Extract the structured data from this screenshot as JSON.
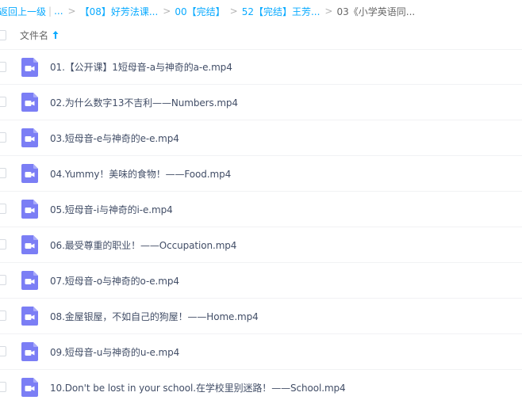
{
  "breadcrumb": {
    "back": "返回上一级",
    "separator": "|",
    "ellipsis": "...",
    "arrow": ">",
    "crumbs": [
      "【08】好芳法课...",
      "00【完结】",
      "52【完结】王芳...",
      "03《小学英语同..."
    ]
  },
  "header": {
    "column_label": "文件名"
  },
  "files": [
    {
      "name": "01.【公开课】1短母音-a与神奇的a-e.mp4",
      "icon": "video-icon"
    },
    {
      "name": "02.为什么数字13不吉利——Numbers.mp4",
      "icon": "video-icon"
    },
    {
      "name": "03.短母音-e与神奇的e-e.mp4",
      "icon": "video-icon"
    },
    {
      "name": "04.Yummy！美味的食物！——Food.mp4",
      "icon": "video-icon"
    },
    {
      "name": "05.短母音-i与神奇的i-e.mp4",
      "icon": "video-icon"
    },
    {
      "name": "06.最受尊重的职业！——Occupation.mp4",
      "icon": "video-icon"
    },
    {
      "name": "07.短母音-o与神奇的o-e.mp4",
      "icon": "video-icon"
    },
    {
      "name": "08.金屋银屋，不如自己的狗屋！——Home.mp4",
      "icon": "video-icon"
    },
    {
      "name": "09.短母音-u与神奇的u-e.mp4",
      "icon": "video-icon"
    },
    {
      "name": "10.Don't be lost in your school.在学校里别迷路！——School.mp4",
      "icon": "video-icon"
    }
  ],
  "colors": {
    "link": "#09aaff",
    "video_icon": "#7b7ef5",
    "text": "#424e67"
  }
}
